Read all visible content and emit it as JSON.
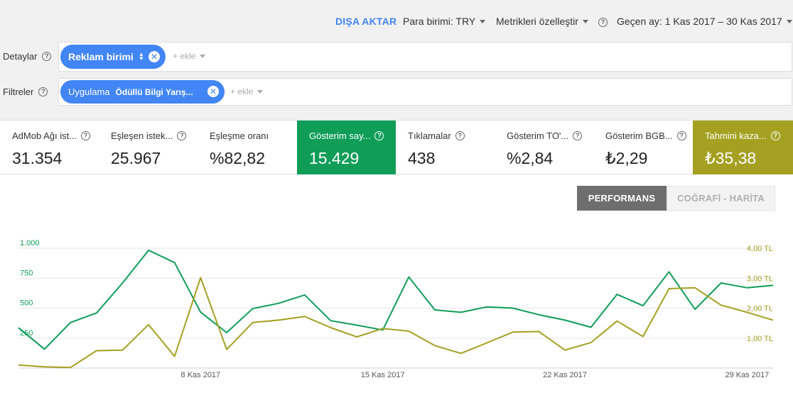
{
  "topbar": {
    "export_label": "DIŞA AKTAR",
    "currency_label": "Para birimi: TRY",
    "customize_label": "Metrikleri özelleştir",
    "date_label": "Geçen ay: 1 Kas 2017 – 30 Kas 2017"
  },
  "details": {
    "label": "Detaylar",
    "chip_label": "Reklam birimi",
    "add_label": "+ ekle"
  },
  "filters": {
    "label": "Filtreler",
    "chip_prefix": "Uygulama",
    "chip_value": "Ödüllü Bilgi Yarış...",
    "add_label": "+ ekle"
  },
  "metrics": [
    {
      "title": "AdMob Ağı ist...",
      "value": "31.354"
    },
    {
      "title": "Eşleşen istek...",
      "value": "25.967"
    },
    {
      "title": "Eşleşme oranı",
      "value": "%82,82"
    },
    {
      "title": "Gösterim say...",
      "value": "15.429",
      "selected_color": "#0f9d58"
    },
    {
      "title": "Tıklamalar",
      "value": "438"
    },
    {
      "title": "Gösterim TO'...",
      "value": "%2,84"
    },
    {
      "title": "Gösterim BGB...",
      "value": "₺2,29"
    },
    {
      "title": "Tahmini kaza...",
      "value": "₺35,38",
      "selected_color": "#a5a021"
    }
  ],
  "view_toggle": {
    "performance_label": "PERFORMANS",
    "map_label": "COĞRAFİ - HARİTA"
  },
  "chart_data": {
    "type": "line",
    "x": [
      "1 Kas 2017",
      "2 Kas 2017",
      "3 Kas 2017",
      "4 Kas 2017",
      "5 Kas 2017",
      "6 Kas 2017",
      "7 Kas 2017",
      "8 Kas 2017",
      "9 Kas 2017",
      "10 Kas 2017",
      "11 Kas 2017",
      "12 Kas 2017",
      "13 Kas 2017",
      "14 Kas 2017",
      "15 Kas 2017",
      "16 Kas 2017",
      "17 Kas 2017",
      "18 Kas 2017",
      "19 Kas 2017",
      "20 Kas 2017",
      "21 Kas 2017",
      "22 Kas 2017",
      "23 Kas 2017",
      "24 Kas 2017",
      "25 Kas 2017",
      "26 Kas 2017",
      "27 Kas 2017",
      "28 Kas 2017",
      "29 Kas 2017",
      "30 Kas 2017"
    ],
    "x_tick_labels": [
      "8 Kas 2017",
      "15 Kas 2017",
      "22 Kas 2017",
      "29 Kas 2017"
    ],
    "x_tick_indices": [
      7,
      14,
      21,
      28
    ],
    "y_left": {
      "ticks": [
        "250",
        "500",
        "750",
        "1.000"
      ],
      "tick_values": [
        250,
        500,
        750,
        1000
      ],
      "range": [
        0,
        1000
      ],
      "color": "#0f9d58"
    },
    "y_right": {
      "ticks": [
        "1,00 TL",
        "2,00 TL",
        "3,00 TL",
        "4,00 TL"
      ],
      "tick_values": [
        1,
        2,
        3,
        4
      ],
      "range": [
        0,
        4
      ],
      "color": "#a5a021"
    },
    "series": [
      {
        "axis": "left",
        "color": "#0f9d58",
        "values": [
          336,
          158,
          380,
          460,
          710,
          983,
          880,
          466,
          296,
          496,
          540,
          610,
          395,
          358,
          318,
          760,
          485,
          465,
          510,
          500,
          445,
          400,
          340,
          615,
          520,
          803,
          490,
          710,
          670,
          690
        ]
      },
      {
        "axis": "right",
        "color": "#a5a021",
        "values": [
          0.1,
          0.04,
          0.02,
          0.58,
          0.6,
          1.45,
          0.39,
          3.02,
          0.62,
          1.52,
          1.6,
          1.72,
          1.35,
          1.04,
          1.32,
          1.23,
          0.75,
          0.49,
          0.84,
          1.2,
          1.22,
          0.6,
          0.85,
          1.57,
          1.05,
          2.65,
          2.68,
          2.1,
          1.86,
          1.6
        ]
      }
    ],
    "grid": true,
    "legend": "none"
  }
}
